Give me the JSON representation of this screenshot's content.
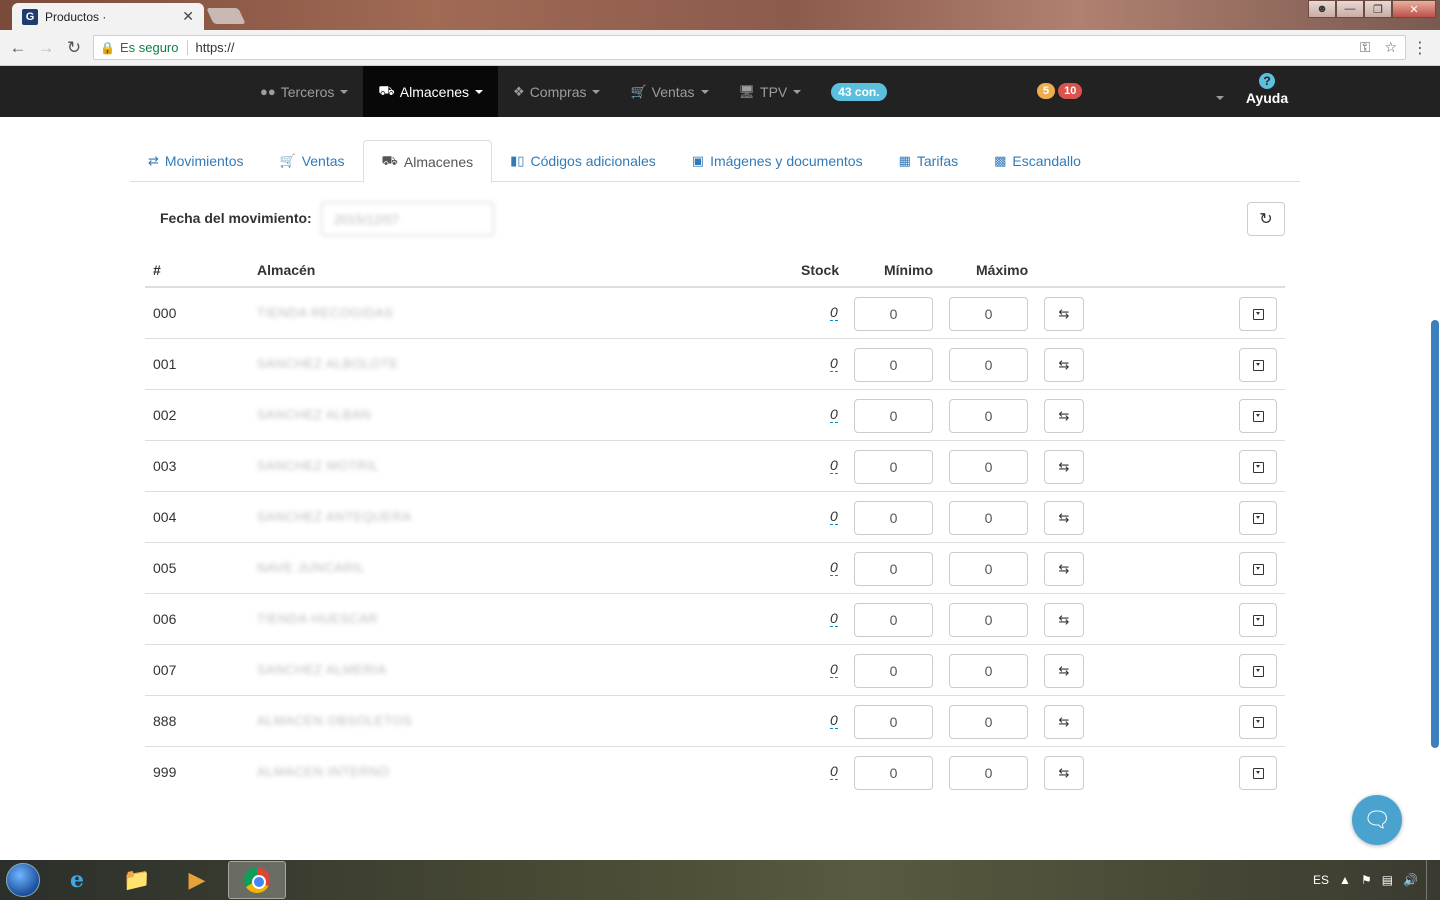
{
  "browser": {
    "tab_title": "Productos ·",
    "tab_favicon": "G",
    "secure_label": "Es seguro",
    "url": "https://"
  },
  "navbar": {
    "items": [
      {
        "label": "Terceros",
        "icon": "users-icon"
      },
      {
        "label": "Almacenes",
        "icon": "truck-icon"
      },
      {
        "label": "Compras",
        "icon": "cubes-icon"
      },
      {
        "label": "Ventas",
        "icon": "cart-icon"
      },
      {
        "label": "TPV",
        "icon": "desktop-icon"
      }
    ],
    "connections_badge": "43 con.",
    "notif_warning": "5",
    "notif_danger": "10",
    "help_label": "Ayuda"
  },
  "tabs": [
    {
      "label": "Movimientos",
      "icon": "exchange-icon"
    },
    {
      "label": "Ventas",
      "icon": "cart-icon"
    },
    {
      "label": "Almacenes",
      "icon": "truck-icon"
    },
    {
      "label": "Códigos adicionales",
      "icon": "barcode-icon"
    },
    {
      "label": "Imágenes y documentos",
      "icon": "image-icon"
    },
    {
      "label": "Tarifas",
      "icon": "table-icon"
    },
    {
      "label": "Escandallo",
      "icon": "chart-icon"
    }
  ],
  "form": {
    "date_label": "Fecha del movimiento:",
    "date_value": "2015/12/07"
  },
  "table": {
    "headers": {
      "code": "#",
      "name": "Almacén",
      "stock": "Stock",
      "min": "Mínimo",
      "max": "Máximo"
    },
    "rows": [
      {
        "code": "000",
        "name": "TIENDA RECOGIDAS",
        "stock": "0",
        "min": "0",
        "max": "0"
      },
      {
        "code": "001",
        "name": "SANCHEZ ALBOLOTE",
        "stock": "0",
        "min": "0",
        "max": "0"
      },
      {
        "code": "002",
        "name": "SANCHEZ ALBAN",
        "stock": "0",
        "min": "0",
        "max": "0"
      },
      {
        "code": "003",
        "name": "SANCHEZ MOTRIL",
        "stock": "0",
        "min": "0",
        "max": "0"
      },
      {
        "code": "004",
        "name": "SANCHEZ ANTEQUERA",
        "stock": "0",
        "min": "0",
        "max": "0"
      },
      {
        "code": "005",
        "name": "NAVE JUNCARIL",
        "stock": "0",
        "min": "0",
        "max": "0"
      },
      {
        "code": "006",
        "name": "TIENDA HUESCAR",
        "stock": "0",
        "min": "0",
        "max": "0"
      },
      {
        "code": "007",
        "name": "SANCHEZ ALMERIA",
        "stock": "0",
        "min": "0",
        "max": "0"
      },
      {
        "code": "888",
        "name": "ALMACEN OBSOLETOS",
        "stock": "0",
        "min": "0",
        "max": "0"
      },
      {
        "code": "999",
        "name": "ALMACEN INTERNO",
        "stock": "0",
        "min": "0",
        "max": "0"
      }
    ]
  },
  "taskbar": {
    "language": "ES"
  },
  "colors": {
    "navbar_bg": "#222222",
    "link": "#337ab7",
    "info_badge": "#5bc0de"
  }
}
